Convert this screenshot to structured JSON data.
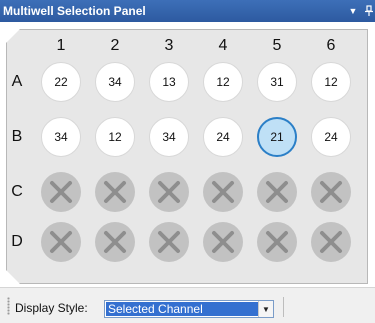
{
  "title": "Multiwell Selection Panel",
  "titlebar": {
    "menu_icon": "chevron-down-icon",
    "pin_icon": "pin-icon"
  },
  "plate": {
    "columns": [
      "1",
      "2",
      "3",
      "4",
      "5",
      "6"
    ],
    "rows": [
      {
        "label": "A",
        "wells": [
          {
            "value": "22",
            "state": "active"
          },
          {
            "value": "34",
            "state": "active"
          },
          {
            "value": "13",
            "state": "active"
          },
          {
            "value": "12",
            "state": "active"
          },
          {
            "value": "31",
            "state": "active"
          },
          {
            "value": "12",
            "state": "active"
          }
        ]
      },
      {
        "label": "B",
        "wells": [
          {
            "value": "34",
            "state": "active"
          },
          {
            "value": "12",
            "state": "active"
          },
          {
            "value": "34",
            "state": "active"
          },
          {
            "value": "24",
            "state": "active"
          },
          {
            "value": "21",
            "state": "selected"
          },
          {
            "value": "24",
            "state": "active"
          }
        ]
      },
      {
        "label": "C",
        "wells": [
          {
            "value": "",
            "state": "disabled"
          },
          {
            "value": "",
            "state": "disabled"
          },
          {
            "value": "",
            "state": "disabled"
          },
          {
            "value": "",
            "state": "disabled"
          },
          {
            "value": "",
            "state": "disabled"
          },
          {
            "value": "",
            "state": "disabled"
          }
        ]
      },
      {
        "label": "D",
        "wells": [
          {
            "value": "",
            "state": "disabled"
          },
          {
            "value": "",
            "state": "disabled"
          },
          {
            "value": "",
            "state": "disabled"
          },
          {
            "value": "",
            "state": "disabled"
          },
          {
            "value": "",
            "state": "disabled"
          },
          {
            "value": "",
            "state": "disabled"
          }
        ]
      }
    ]
  },
  "footer": {
    "display_style_label": "Display Style:",
    "display_style_value": "Selected Channel",
    "dropdown_icon": "chevron-down-icon"
  },
  "colors": {
    "titlebar": "#2d5aa0",
    "selected_well_fill": "#bfe0f6",
    "selected_well_border": "#2b7fc7",
    "disabled_well": "#c2c2c2",
    "combo_highlight": "#3470d0"
  }
}
